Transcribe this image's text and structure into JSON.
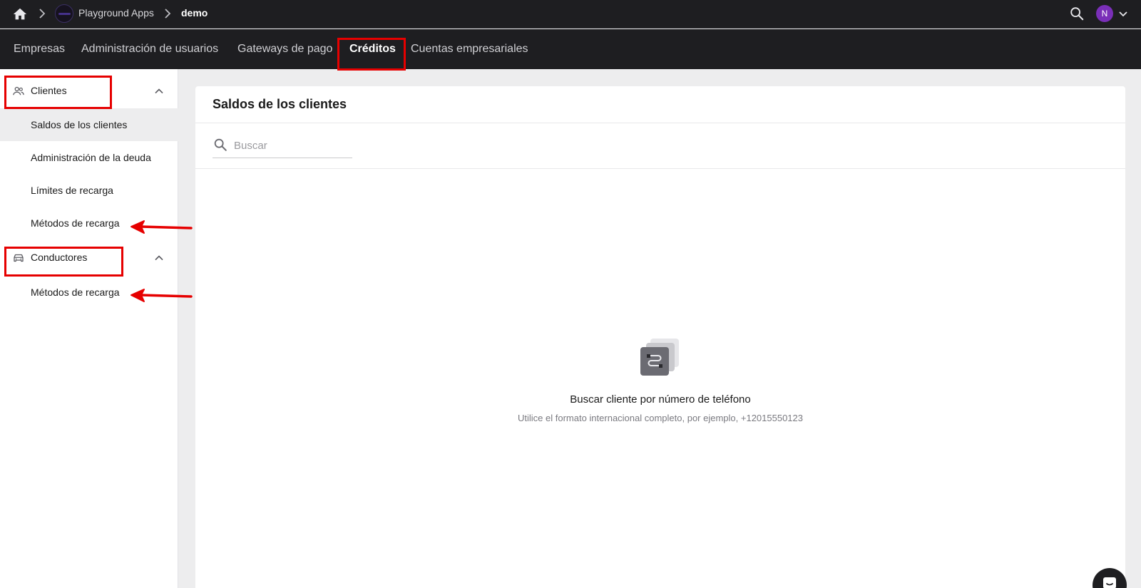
{
  "breadcrumb": {
    "org_name": "Playground Apps",
    "current": "demo"
  },
  "user": {
    "initial": "N",
    "avatar_color": "#7a2fb8"
  },
  "nav": {
    "items": [
      {
        "label": "Empresas"
      },
      {
        "label": "Administración de usuarios"
      },
      {
        "label": "Gateways de pago"
      },
      {
        "label": "Créditos",
        "active": true
      },
      {
        "label": "Cuentas empresariales"
      }
    ]
  },
  "sidebar": {
    "groups": [
      {
        "label": "Clientes",
        "icon": "people-icon",
        "expanded": true,
        "items": [
          {
            "label": "Saldos de los clientes",
            "selected": true
          },
          {
            "label": "Administración de la deuda"
          },
          {
            "label": "Límites de recarga"
          },
          {
            "label": "Métodos de recarga"
          }
        ]
      },
      {
        "label": "Conductores",
        "icon": "car-icon",
        "expanded": true,
        "items": [
          {
            "label": "Métodos de recarga"
          }
        ]
      }
    ]
  },
  "main": {
    "title": "Saldos de los clientes",
    "search": {
      "placeholder": "Buscar",
      "value": ""
    },
    "empty_state": {
      "title": "Buscar cliente por número de teléfono",
      "description": "Utilice el formato internacional completo, por ejemplo, +12015550123"
    }
  },
  "colors": {
    "topbar_bg": "#1e1e21",
    "annotation_red": "#e60000",
    "page_bg": "#ededee"
  }
}
